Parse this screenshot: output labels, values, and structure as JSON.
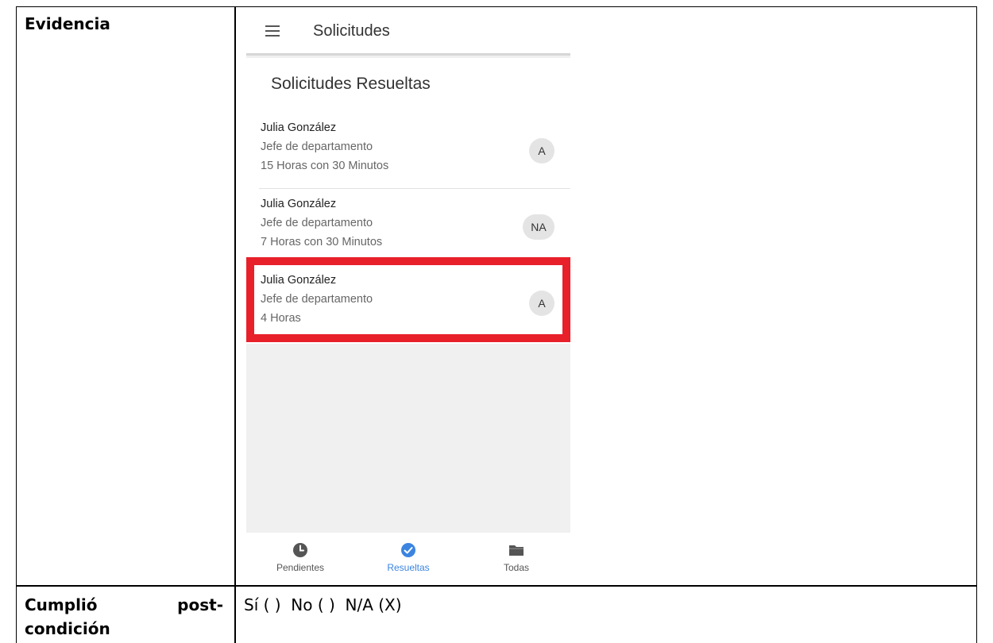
{
  "document": {
    "evidence_label": "Evidencia",
    "post_label_line1_left": "Cumplió",
    "post_label_line1_right": "post-",
    "post_label_line2": "condición",
    "post_values": "Sí ( )  No ( )  N/A (X)"
  },
  "app": {
    "title": "Solicitudes",
    "menu_icon": "menu-icon",
    "section_title": "Solicitudes Resueltas",
    "items": [
      {
        "name": "Julia González",
        "role": "Jefe de departamento",
        "duration": "15 Horas con 30 Minutos",
        "status": "A"
      },
      {
        "name": "Julia González",
        "role": "Jefe de departamento",
        "duration": "7 Horas con 30 Minutos",
        "status": "NA"
      },
      {
        "name": "Julia González",
        "role": "Jefe de departamento",
        "duration": "4 Horas",
        "status": "A"
      }
    ],
    "highlighted_item": 2,
    "highlight_color": "#e8202a",
    "nav": [
      {
        "label": "Pendientes",
        "icon": "clock-icon",
        "active": false
      },
      {
        "label": "Resueltas",
        "icon": "check-circle-icon",
        "active": true
      },
      {
        "label": "Todas",
        "icon": "folder-icon",
        "active": false
      }
    ],
    "accent_color": "#3b84e0"
  }
}
